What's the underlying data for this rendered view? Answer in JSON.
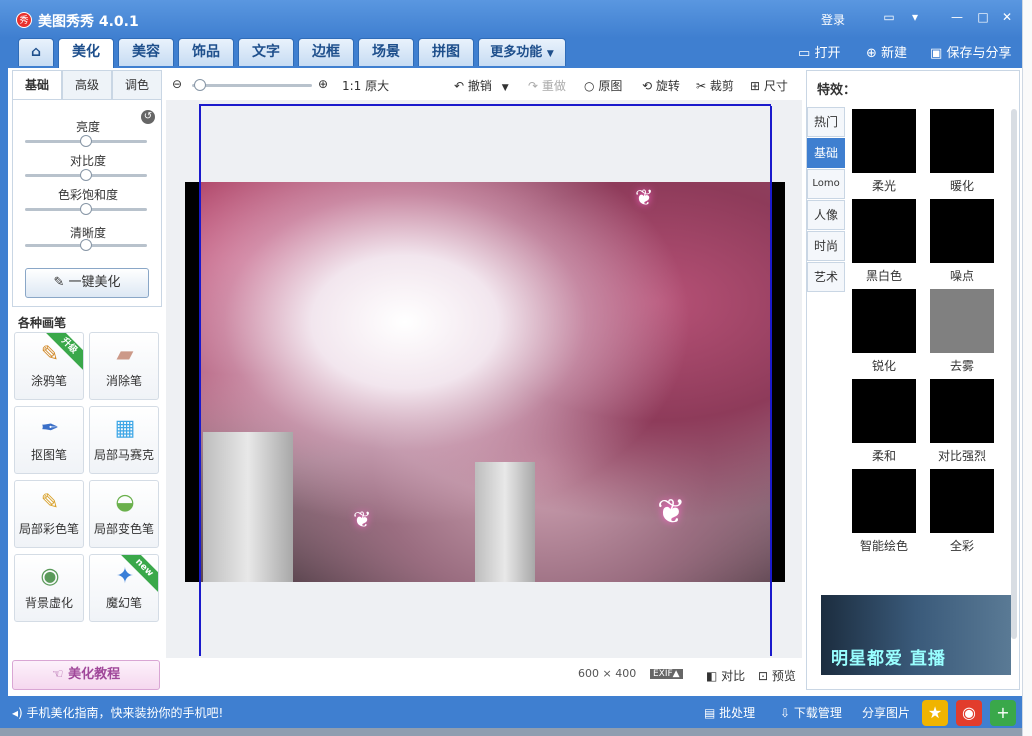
{
  "titlebar": {
    "app_icon_label": "秀",
    "title": "美图秀秀 4.0.1",
    "login": "登录"
  },
  "tabs": [
    {
      "label": "美化"
    },
    {
      "label": "美容"
    },
    {
      "label": "饰品"
    },
    {
      "label": "文字"
    },
    {
      "label": "边框"
    },
    {
      "label": "场景"
    },
    {
      "label": "拼图"
    },
    {
      "label": "更多功能"
    }
  ],
  "top_actions": {
    "open": "打开",
    "new": "新建",
    "save": "保存与分享"
  },
  "left": {
    "subtabs": [
      "基础",
      "高级",
      "调色"
    ],
    "sliders": [
      {
        "label": "亮度",
        "level": 0.5
      },
      {
        "label": "对比度",
        "level": 0.5
      },
      {
        "label": "色彩饱和度",
        "level": 0.5
      },
      {
        "label": "清晰度",
        "level": 0.5
      }
    ],
    "onekey": "一键美化",
    "brushes_title": "各种画笔",
    "brushes": [
      {
        "label": "涂鸦笔",
        "ribbon": "升级"
      },
      {
        "label": "消除笔",
        "ribbon": ""
      },
      {
        "label": "抠图笔",
        "ribbon": ""
      },
      {
        "label": "局部马赛克",
        "ribbon": ""
      },
      {
        "label": "局部彩色笔",
        "ribbon": ""
      },
      {
        "label": "局部变色笔",
        "ribbon": ""
      },
      {
        "label": "背景虚化",
        "ribbon": ""
      },
      {
        "label": "魔幻笔",
        "ribbon": "new"
      }
    ],
    "tutorial": "美化教程"
  },
  "center": {
    "zoom_label": "1:1 原大",
    "undo": "撤销",
    "redo": "重做",
    "original": "原图",
    "rotate": "旋转",
    "crop": "裁剪",
    "size": "尺寸",
    "dimensions": "600 × 400",
    "exif": "EXIF▲",
    "compare": "对比",
    "preview": "预览"
  },
  "right": {
    "title": "特效：",
    "categories": [
      "热门",
      "基础",
      "Lomo",
      "人像",
      "时尚",
      "艺术"
    ],
    "effects": [
      "柔光",
      "暖化",
      "黑白色",
      "噪点",
      "锐化",
      "去雾",
      "柔和",
      "对比强烈",
      "智能绘色",
      "全彩"
    ],
    "banner_text": "明星都爱 直播"
  },
  "bottom": {
    "tip": "手机美化指南，快来装扮你的手机吧!",
    "batch": "批处理",
    "download": "下载管理",
    "share": "分享图片"
  }
}
